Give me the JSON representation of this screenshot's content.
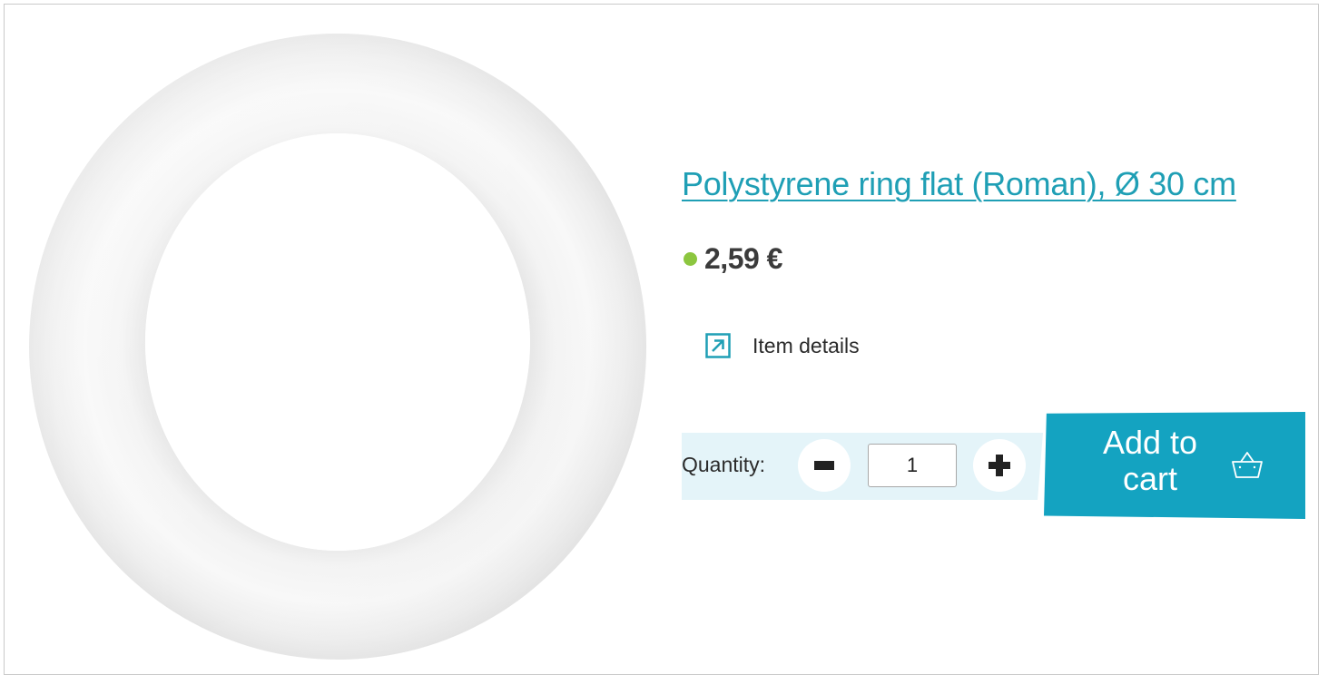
{
  "product": {
    "title": "Polystyrene ring flat (Roman), Ø 30 cm",
    "price": "2,59 €",
    "details_label": "Item details",
    "image_icon": "polystyrene-ring-image"
  },
  "purchase": {
    "quantity_label": "Quantity:",
    "quantity_value": "1",
    "add_to_cart_line1": "Add to",
    "add_to_cart_line2": "cart",
    "decrease_icon": "minus-icon",
    "increase_icon": "plus-icon",
    "cart_icon": "basket-icon"
  },
  "colors": {
    "accent": "#1f9fb5",
    "cart_button": "#14a3c1",
    "stock_in": "#8cc63f",
    "quantity_band": "#e4f4f9",
    "price_text": "#3b3b3b"
  }
}
